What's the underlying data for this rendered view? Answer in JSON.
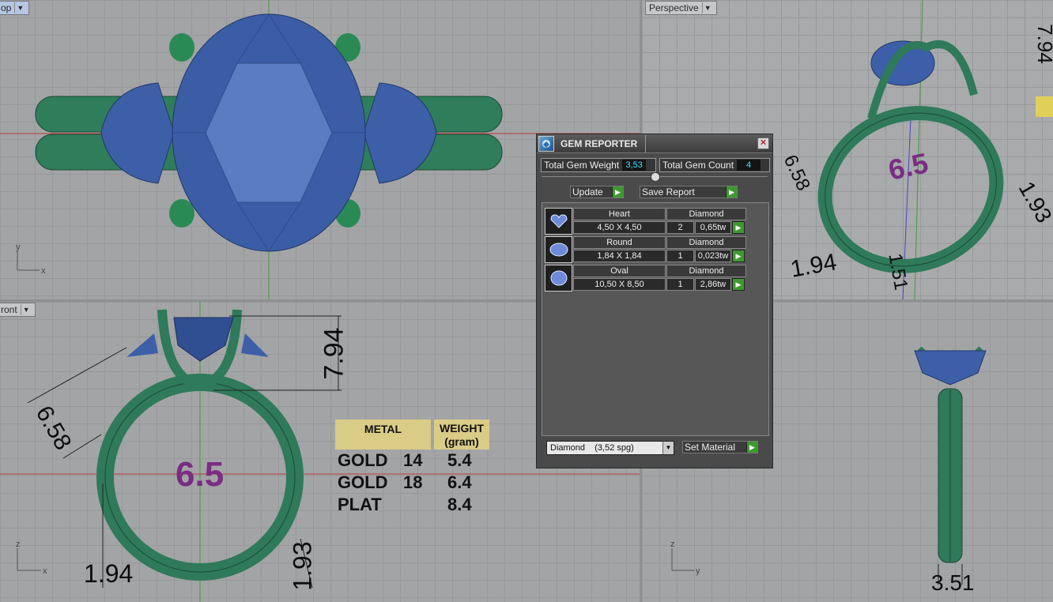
{
  "viewports": {
    "top": {
      "label": "op"
    },
    "perspective": {
      "label": "Perspective"
    },
    "front": {
      "label": "ront"
    },
    "right": {
      "label": ""
    }
  },
  "axes": {
    "top": [
      "y",
      "x"
    ],
    "front": [
      "z",
      "x"
    ],
    "right": [
      "z",
      "y"
    ]
  },
  "dimensions": {
    "front_height": "7.94",
    "front_diag": "6.58",
    "front_bottom_left": "1.94",
    "front_bottom_right": "1.93",
    "persp_top": "7.94",
    "persp_left": "6.58",
    "persp_right": "1.93",
    "persp_bottom": "1.94",
    "persp_bottom2": "1.51",
    "right_width": "3.51"
  },
  "ring_size": "6.5",
  "metal_table": {
    "header_metal": "METAL",
    "header_weight": "WEIGHT (gram)",
    "rows": [
      {
        "metal": "GOLD",
        "karat": "14",
        "weight": "5.4"
      },
      {
        "metal": "GOLD",
        "karat": "18",
        "weight": "6.4"
      },
      {
        "metal": "PLAT",
        "karat": "",
        "weight": "8.4"
      }
    ]
  },
  "gem_reporter": {
    "title": "GEM REPORTER",
    "total_weight_label": "Total Gem Weight",
    "total_weight": "3,53",
    "total_count_label": "Total Gem Count",
    "total_count": "4",
    "update_label": "Update",
    "save_report_label": "Save Report",
    "gems": [
      {
        "shape": "Heart",
        "material": "Diamond",
        "size": "4,50 X 4,50",
        "qty": "2",
        "weight": "0,65tw"
      },
      {
        "shape": "Round",
        "material": "Diamond",
        "size": "1,84 X 1,84",
        "qty": "1",
        "weight": "0,023tw"
      },
      {
        "shape": "Oval",
        "material": "Diamond",
        "size": "10,50 X 8,50",
        "qty": "1",
        "weight": "2,86tw"
      }
    ],
    "material_select": "Diamond    (3,52 spg)",
    "set_material_label": "Set Material"
  },
  "colors": {
    "metal": "#2e7a5a",
    "gem": "#3a5fa6",
    "ring_size_text": "#7a2d83"
  }
}
